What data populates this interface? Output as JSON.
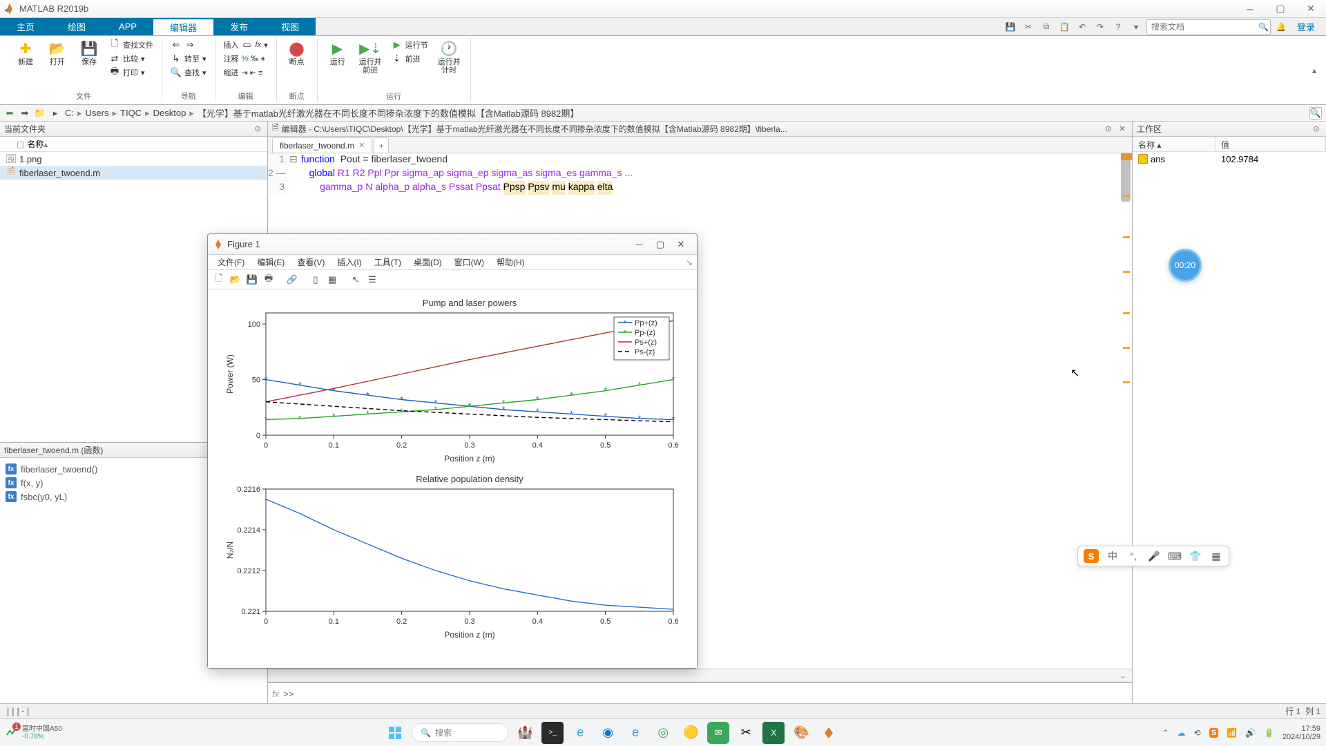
{
  "app": {
    "title": "MATLAB R2019b",
    "login": "登录"
  },
  "ribbon": {
    "tabs": [
      "主页",
      "绘图",
      "APP",
      "编辑器",
      "发布",
      "视图"
    ],
    "search_placeholder": "搜索文档"
  },
  "toolstrip": {
    "file": {
      "label": "文件",
      "new": "新建",
      "open": "打开",
      "save": "保存",
      "findfiles": "查找文件",
      "compare": "比较",
      "print": "打印"
    },
    "nav": {
      "label": "导航",
      "goto": "转至",
      "find": "查找"
    },
    "edit": {
      "label": "编辑",
      "insert": "插入",
      "comment": "注释",
      "indent": "缩进"
    },
    "breakpoints": {
      "label": "断点",
      "btn": "断点"
    },
    "run": {
      "label": "运行",
      "run": "运行",
      "run_advance": "运行并\n前进",
      "run_section": "运行节",
      "advance": "前进",
      "run_time": "运行并\n计时"
    }
  },
  "path": {
    "drive": "C:",
    "segs": [
      "Users",
      "TIQC",
      "Desktop"
    ],
    "folder": "【光学】基于matlab光纤激光器在不同长度不同掺杂浓度下的数值模拟【含Matlab源码 8982期】"
  },
  "left": {
    "title": "当前文件夹",
    "name_col": "名称",
    "files": [
      "1.png",
      "fiberlaser_twoend.m"
    ],
    "details_title": "fiberlaser_twoend.m (函数)",
    "functions": [
      "fiberlaser_twoend()",
      "f(x, y)",
      "fsbc(y0, yL)"
    ]
  },
  "editor": {
    "title_prefix": "编辑器 - C:\\Users\\TIQC\\Desktop\\【光学】基于matlab光纤激光器在不同长度不同掺杂浓度下的数值模拟【含Matlab源码 8982期】\\fiberla...",
    "tab": "fiberlaser_twoend.m",
    "lines": {
      "l1a": "function",
      "l1b": "  Pout = fiberlaser_twoend",
      "l2a": "global",
      "l2b": " R1 R2 Ppl Ppr sigma_ap sigma_ep sigma_as sigma_es gamma_s ...",
      "l3a": "gamma_p N alpha_p alpha_s Pssat Ppsat ",
      "l3_hl": [
        "Ppsp",
        "Ppsv",
        "mu",
        "kappa",
        "elta"
      ]
    }
  },
  "workspace": {
    "title": "工作区",
    "cols": {
      "name": "名称",
      "value": "值"
    },
    "vars": [
      {
        "name": "ans",
        "value": "102.9784"
      }
    ]
  },
  "figure": {
    "title": "Figure 1",
    "menus": [
      "文件(F)",
      "编辑(E)",
      "查看(V)",
      "插入(I)",
      "工具(T)",
      "桌面(D)",
      "窗口(W)",
      "帮助(H)"
    ]
  },
  "chart_data": [
    {
      "type": "line",
      "title": "Pump and laser powers",
      "xlabel": "Position z (m)",
      "ylabel": "Power (W)",
      "xlim": [
        0,
        0.6
      ],
      "ylim": [
        0,
        110
      ],
      "xticks": [
        0,
        0.1,
        0.2,
        0.3,
        0.4,
        0.5,
        0.6
      ],
      "yticks": [
        0,
        50,
        100
      ],
      "series": [
        {
          "name": "Pp+(z)",
          "style": "blue-marker",
          "x": [
            0,
            0.05,
            0.1,
            0.15,
            0.2,
            0.25,
            0.3,
            0.35,
            0.4,
            0.45,
            0.5,
            0.55,
            0.6
          ],
          "y": [
            50,
            45,
            40,
            36,
            32,
            29,
            26,
            23,
            21,
            19,
            17,
            15,
            14
          ]
        },
        {
          "name": "Pp-(z)",
          "style": "green-marker",
          "x": [
            0,
            0.05,
            0.1,
            0.15,
            0.2,
            0.25,
            0.3,
            0.35,
            0.4,
            0.45,
            0.5,
            0.55,
            0.6
          ],
          "y": [
            14,
            15,
            17,
            19,
            21,
            23,
            26,
            29,
            32,
            36,
            40,
            45,
            50
          ]
        },
        {
          "name": "Ps+(z)",
          "style": "red-line",
          "x": [
            0,
            0.1,
            0.2,
            0.3,
            0.4,
            0.5,
            0.6
          ],
          "y": [
            30,
            42,
            55,
            68,
            80,
            92,
            103
          ]
        },
        {
          "name": "Ps-(z)",
          "style": "black-dash",
          "x": [
            0,
            0.1,
            0.2,
            0.3,
            0.4,
            0.5,
            0.6
          ],
          "y": [
            30,
            26,
            22,
            19,
            16,
            14,
            12
          ]
        }
      ],
      "legend": [
        "Pp+(z)",
        "Pp-(z)",
        "Ps+(z)",
        "Ps-(z)"
      ]
    },
    {
      "type": "line",
      "title": "Relative population density",
      "xlabel": "Position z (m)",
      "ylabel": "N₂/N",
      "xlim": [
        0,
        0.6
      ],
      "ylim": [
        0.221,
        0.2216
      ],
      "xticks": [
        0,
        0.1,
        0.2,
        0.3,
        0.4,
        0.5,
        0.6
      ],
      "yticks": [
        0.221,
        0.2212,
        0.2214,
        0.2216
      ],
      "series": [
        {
          "name": "N2/N",
          "style": "blue-line",
          "x": [
            0,
            0.05,
            0.1,
            0.15,
            0.2,
            0.25,
            0.3,
            0.35,
            0.4,
            0.45,
            0.5,
            0.55,
            0.6
          ],
          "y": [
            0.22155,
            0.22148,
            0.2214,
            0.22133,
            0.22126,
            0.2212,
            0.22115,
            0.22111,
            0.22108,
            0.22105,
            0.22103,
            0.22102,
            0.22101
          ]
        }
      ]
    }
  ],
  "status": {
    "left": "|||-|",
    "line": "行",
    "line_n": "1",
    "col": "列",
    "col_n": "1"
  },
  "timer": "00:20",
  "ime": {
    "lang": "中"
  },
  "taskbar": {
    "stock": {
      "name": "富时中国A50",
      "change": "-0.78%",
      "badge": "1"
    },
    "search": "搜索",
    "clock": {
      "time": "17:59",
      "date": "2024/10/29"
    }
  }
}
